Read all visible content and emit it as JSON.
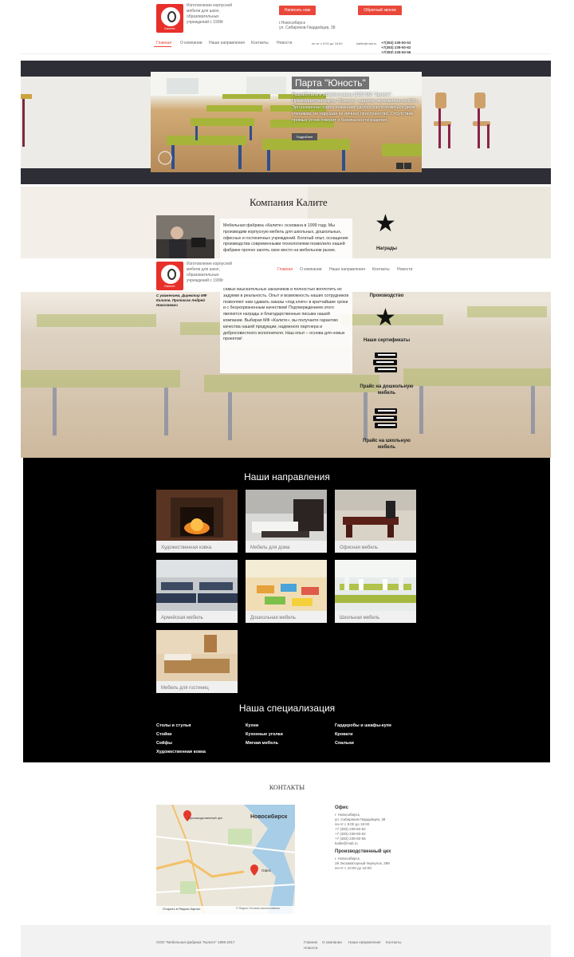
{
  "header": {
    "logo_text": "Калите",
    "tagline": "Изготовление корпусной мебели для школ, образовательных учреждений с 1999г",
    "btn_write": "Написать нам",
    "btn_call": "Обратный звонок",
    "city": "г.Новосибирск",
    "street": "ул. Сибиряков-Гвардейцев, 38",
    "hours": "пн-пт с 9:00 до 18:00",
    "email": "kalite@mail.ru",
    "phones": [
      "+7(383) 239-50-52",
      "+7(383) 239-50-62",
      "+7(383) 239-50-56"
    ],
    "nav": [
      "Главная",
      "О компании",
      "Наши направления",
      "Контакты",
      "Новости"
    ]
  },
  "slider": {
    "title": "Парта \"Юность\"",
    "text": "Разработана и запатентована ООО МФ \"Калите\". Преимущества парты \"Юность\": изделие экономично на 600 г. Эргономичная парта повышает удобно расположиться двум ученикам, не нарушая их личное пространство. Отсутствие прямых углов говорит о безопасности изделия.",
    "button": "Подробнее"
  },
  "company": {
    "title": "Компания Калите",
    "text_top": "Мебельная фабрика «Калите» основана в 1999 году. Мы производим корпусную мебель для школьных, дошкольных, офисных и гостиничных учреждений. Богатый опыт, оснащение производства современными технологиями позволило нашей фабрике прочно занять свое место на мебельном рынке.",
    "text_bottom": "самых взыскательных заказчиков и полностью воплотить их задумки в реальность. Опыт и возможность наших сотрудников позволяют нам сдавать заказы «под ключ» в кратчайшие сроки и с безукоризненным качеством! Подтверждением этого являются награды и благодарственные письма нашей компании. Выбирая МФ «Калите», вы получаете гарантию качества нашей продукции, надежного партнера и добросовестного исполнителя. Наш опыт – основа для новых проектов!",
    "signature": "С уважением, Директор МФ Калите, Протасов Андрей Николаевич"
  },
  "awards": [
    "Награды",
    "Производство",
    "Наши сертификаты",
    "Прайс на дошкольную мебель",
    "Прайс на школьную мебель"
  ],
  "directions": {
    "title": "Наши направления",
    "items": [
      "Художественная ковка",
      "Мебель для дома",
      "Офисная мебель",
      "Армейская мебель",
      "Дошкольная мебель",
      "Школьная мебель",
      "Мебель для гостиниц"
    ]
  },
  "specialization": {
    "title": "Наша специализация",
    "col1": [
      "Столы и стулья",
      "Стойки",
      "Сейфы",
      "Художественная ковка"
    ],
    "col2": [
      "Кухни",
      "Кухонные уголки",
      "Мягкая мебель"
    ],
    "col3": [
      "Гардеробы и шкафы-купе",
      "Кровати",
      "Спальни"
    ]
  },
  "contacts": {
    "title": "КОНТАКТЫ",
    "map_city": "Новосибирск",
    "map_label_prod": "Производственный цех",
    "map_label_office": "Офис",
    "map_open": "Открыть в Яндекс.Картах",
    "map_terms": "© Яндекс Условия использования",
    "office_title": "Офис",
    "office_lines": [
      "г. Новосибирск,",
      "ул. Сибиряков-Гвардейцев, 38",
      "пн-пт с 9:00 до 18:00",
      "+7 (383) 239-50-52",
      "+7 (383) 239-50-62",
      "+7 (383) 239-50-56",
      "kalite@mail.ru"
    ],
    "prod_title": "Производственный цех",
    "prod_lines": [
      "г. Новосибирск,",
      "2й Экскаваторный переулок, 298",
      "пн-пт с 10:00 до 18:00"
    ]
  },
  "footer": {
    "copyright": "ООО \"Мебельная фабрика \"Калите\" 1999-2017",
    "links": [
      "Главная",
      "О компании",
      "Наши направления",
      "Контакты",
      "Новости"
    ]
  },
  "colors": {
    "accent": "#e9473a",
    "dark": "#000000"
  }
}
